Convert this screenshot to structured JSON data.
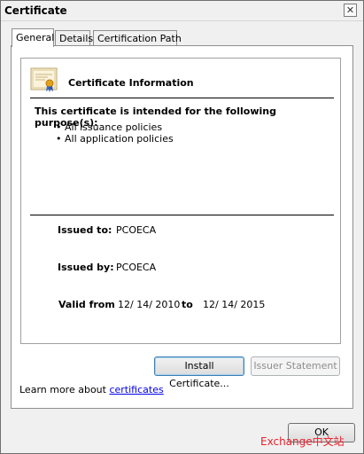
{
  "window": {
    "title": "Certificate",
    "close_glyph": "✕"
  },
  "tabs": [
    {
      "label": "General",
      "active": true
    },
    {
      "label": "Details",
      "active": false
    },
    {
      "label": "Certification Path",
      "active": false
    }
  ],
  "general": {
    "heading": "Certificate Information",
    "purpose_text": "This certificate is intended for the following purpose(s):",
    "policies": [
      "• All issuance policies",
      "• All application policies"
    ],
    "issued_to_label": "Issued to:",
    "issued_to_value": "PCOECA",
    "issued_by_label": "Issued by:",
    "issued_by_value": "PCOECA",
    "valid_from_label": "Valid from",
    "valid_from_value": "12/ 14/ 2010",
    "valid_to_label": "to",
    "valid_to_value": "12/ 14/ 2015"
  },
  "buttons": {
    "install": "Install Certificate...",
    "issuer": "Issuer Statement",
    "ok": "OK"
  },
  "learn_more": {
    "prefix": "Learn more about ",
    "link": "certificates"
  },
  "watermark": "Exchange中文站",
  "icons": {
    "certificate": "certificate-icon",
    "close": "close-icon"
  },
  "colors": {
    "link": "#0000ee",
    "watermark": "#e8202a"
  }
}
